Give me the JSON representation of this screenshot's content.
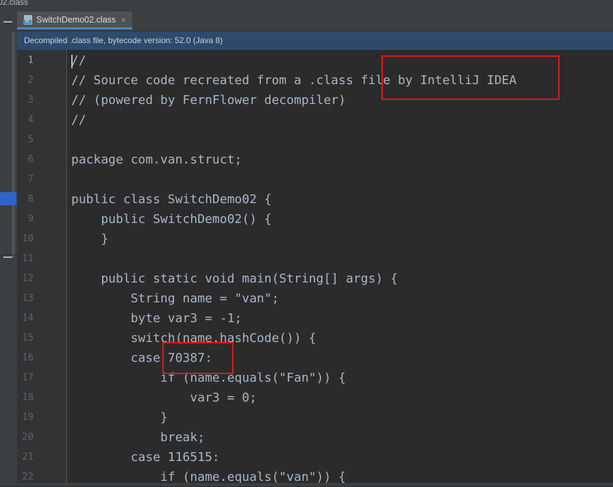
{
  "window": {
    "path_fragment": "02.class"
  },
  "tab": {
    "label": "SwitchDemo02.class",
    "icon_text": "01",
    "close_glyph": "×"
  },
  "banner": {
    "text": "Decompiled .class file, bytecode version: 52.0 (Java 8)"
  },
  "editor": {
    "lines": [
      {
        "num": "1",
        "code": "//"
      },
      {
        "num": "2",
        "code": "// Source code recreated from a .class file by IntelliJ IDEA"
      },
      {
        "num": "3",
        "code": "// (powered by FernFlower decompiler)"
      },
      {
        "num": "4",
        "code": "//"
      },
      {
        "num": "5",
        "code": ""
      },
      {
        "num": "6",
        "code": "package com.van.struct;"
      },
      {
        "num": "7",
        "code": ""
      },
      {
        "num": "8",
        "code": "public class SwitchDemo02 {"
      },
      {
        "num": "9",
        "code": "    public SwitchDemo02() {"
      },
      {
        "num": "10",
        "code": "    }"
      },
      {
        "num": "11",
        "code": ""
      },
      {
        "num": "12",
        "code": "    public static void main(String[] args) {"
      },
      {
        "num": "13",
        "code": "        String name = \"van\";"
      },
      {
        "num": "14",
        "code": "        byte var3 = -1;"
      },
      {
        "num": "15",
        "code": "        switch(name.hashCode()) {"
      },
      {
        "num": "16",
        "code": "        case 70387:"
      },
      {
        "num": "17",
        "code": "            if (name.equals(\"Fan\")) {"
      },
      {
        "num": "18",
        "code": "                var3 = 0;"
      },
      {
        "num": "19",
        "code": "            }"
      },
      {
        "num": "20",
        "code": "            break;"
      },
      {
        "num": "21",
        "code": "        case 116515:"
      },
      {
        "num": "22",
        "code": "            if (name.equals(\"van\")) {"
      }
    ]
  },
  "colors": {
    "code_text": "#a9b7c6",
    "annotation_box": "#e01a1a",
    "banner_bg": "#2c4a6b"
  }
}
